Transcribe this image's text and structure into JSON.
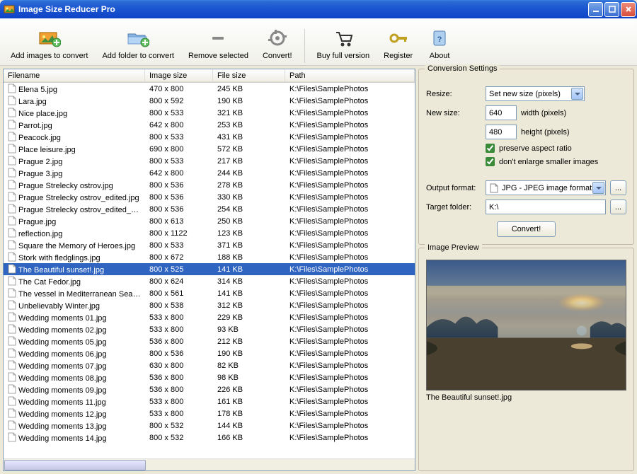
{
  "window": {
    "title": "Image Size Reducer Pro"
  },
  "toolbar": {
    "addImages": "Add images to convert",
    "addFolder": "Add folder to convert",
    "removeSelected": "Remove selected",
    "convert": "Convert!",
    "buyFull": "Buy full version",
    "register": "Register",
    "about": "About"
  },
  "columns": {
    "filename": "Filename",
    "imagesize": "Image size",
    "filesize": "File size",
    "path": "Path"
  },
  "files": [
    {
      "name": "Elena 5.jpg",
      "isize": "470 x 800",
      "fsize": "245 KB",
      "path": "K:\\Files\\SamplePhotos"
    },
    {
      "name": "Lara.jpg",
      "isize": "800 x 592",
      "fsize": "190 KB",
      "path": "K:\\Files\\SamplePhotos"
    },
    {
      "name": "Nice place.jpg",
      "isize": "800 x 533",
      "fsize": "321 KB",
      "path": "K:\\Files\\SamplePhotos"
    },
    {
      "name": "Parrot.jpg",
      "isize": "642 x 800",
      "fsize": "253 KB",
      "path": "K:\\Files\\SamplePhotos"
    },
    {
      "name": "Peacock.jpg",
      "isize": "800 x 533",
      "fsize": "431 KB",
      "path": "K:\\Files\\SamplePhotos"
    },
    {
      "name": "Place leisure.jpg",
      "isize": "690 x 800",
      "fsize": "572 KB",
      "path": "K:\\Files\\SamplePhotos"
    },
    {
      "name": "Prague 2.jpg",
      "isize": "800 x 533",
      "fsize": "217 KB",
      "path": "K:\\Files\\SamplePhotos"
    },
    {
      "name": "Prague 3.jpg",
      "isize": "642 x 800",
      "fsize": "244 KB",
      "path": "K:\\Files\\SamplePhotos"
    },
    {
      "name": "Prague Strelecky ostrov.jpg",
      "isize": "800 x 536",
      "fsize": "278 KB",
      "path": "K:\\Files\\SamplePhotos"
    },
    {
      "name": "Prague Strelecky ostrov_edited.jpg",
      "isize": "800 x 536",
      "fsize": "330 KB",
      "path": "K:\\Files\\SamplePhotos"
    },
    {
      "name": "Prague Strelecky ostrov_edited_2...",
      "isize": "800 x 536",
      "fsize": "254 KB",
      "path": "K:\\Files\\SamplePhotos"
    },
    {
      "name": "Prague.jpg",
      "isize": "800 x 613",
      "fsize": "250 KB",
      "path": "K:\\Files\\SamplePhotos"
    },
    {
      "name": "reflection.jpg",
      "isize": "800 x 1122",
      "fsize": "123 KB",
      "path": "K:\\Files\\SamplePhotos"
    },
    {
      "name": "Square the Memory of Heroes.jpg",
      "isize": "800 x 533",
      "fsize": "371 KB",
      "path": "K:\\Files\\SamplePhotos"
    },
    {
      "name": "Stork with fledglings.jpg",
      "isize": "800 x 672",
      "fsize": "188 KB",
      "path": "K:\\Files\\SamplePhotos"
    },
    {
      "name": "The Beautiful sunset!.jpg",
      "isize": "800 x 525",
      "fsize": "141 KB",
      "path": "K:\\Files\\SamplePhotos",
      "selected": true
    },
    {
      "name": "The Cat Fedor.jpg",
      "isize": "800 x 624",
      "fsize": "314 KB",
      "path": "K:\\Files\\SamplePhotos"
    },
    {
      "name": "The vessel in Mediterranean Sea.jpg",
      "isize": "800 x 561",
      "fsize": "141 KB",
      "path": "K:\\Files\\SamplePhotos"
    },
    {
      "name": "Unbelievably Winter.jpg",
      "isize": "800 x 538",
      "fsize": "312 KB",
      "path": "K:\\Files\\SamplePhotos"
    },
    {
      "name": "Wedding moments 01.jpg",
      "isize": "533 x 800",
      "fsize": "229 KB",
      "path": "K:\\Files\\SamplePhotos"
    },
    {
      "name": "Wedding moments 02.jpg",
      "isize": "533 x 800",
      "fsize": "93 KB",
      "path": "K:\\Files\\SamplePhotos"
    },
    {
      "name": "Wedding moments 05.jpg",
      "isize": "536 x 800",
      "fsize": "212 KB",
      "path": "K:\\Files\\SamplePhotos"
    },
    {
      "name": "Wedding moments 06.jpg",
      "isize": "800 x 536",
      "fsize": "190 KB",
      "path": "K:\\Files\\SamplePhotos"
    },
    {
      "name": "Wedding moments 07.jpg",
      "isize": "630 x 800",
      "fsize": "82 KB",
      "path": "K:\\Files\\SamplePhotos"
    },
    {
      "name": "Wedding moments 08.jpg",
      "isize": "536 x 800",
      "fsize": "98 KB",
      "path": "K:\\Files\\SamplePhotos"
    },
    {
      "name": "Wedding moments 09.jpg",
      "isize": "536 x 800",
      "fsize": "226 KB",
      "path": "K:\\Files\\SamplePhotos"
    },
    {
      "name": "Wedding moments 11.jpg",
      "isize": "533 x 800",
      "fsize": "161 KB",
      "path": "K:\\Files\\SamplePhotos"
    },
    {
      "name": "Wedding moments 12.jpg",
      "isize": "533 x 800",
      "fsize": "178 KB",
      "path": "K:\\Files\\SamplePhotos"
    },
    {
      "name": "Wedding moments 13.jpg",
      "isize": "800 x 532",
      "fsize": "144 KB",
      "path": "K:\\Files\\SamplePhotos"
    },
    {
      "name": "Wedding moments 14.jpg",
      "isize": "800 x 532",
      "fsize": "166 KB",
      "path": "K:\\Files\\SamplePhotos"
    }
  ],
  "settings": {
    "title": "Conversion Settings",
    "resizeLabel": "Resize:",
    "resizeMode": "Set new size (pixels)",
    "newSizeLabel": "New size:",
    "width": "640",
    "widthLabel": "width  (pixels)",
    "height": "480",
    "heightLabel": "height  (pixels)",
    "preserveAspect": "preserve aspect ratio",
    "dontEnlarge": "don't enlarge smaller images",
    "outputFormatLabel": "Output format:",
    "outputFormat": "JPG - JPEG image format",
    "targetFolderLabel": "Target folder:",
    "targetFolder": "K:\\",
    "convertBtn": "Convert!",
    "browseBtn": "..."
  },
  "preview": {
    "title": "Image Preview",
    "caption": "The Beautiful sunset!.jpg"
  }
}
